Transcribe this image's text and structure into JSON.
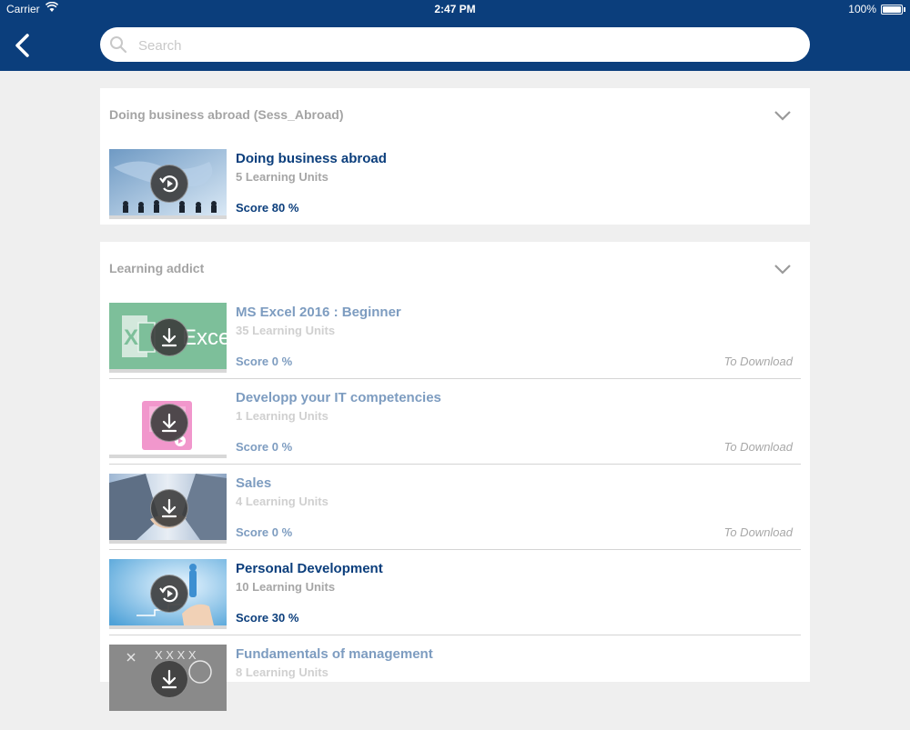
{
  "status_bar": {
    "carrier": "Carrier",
    "time": "2:47 PM",
    "battery": "100%"
  },
  "search": {
    "placeholder": "Search",
    "value": ""
  },
  "sections": [
    {
      "title": "Doing business abroad (Sess_Abroad)",
      "items": [
        {
          "title": "Doing business abroad",
          "units": "5 Learning Units",
          "score": "Score 80 %",
          "status": "",
          "icon": "resume-icon"
        }
      ]
    },
    {
      "title": "Learning addict",
      "items": [
        {
          "title": "MS Excel 2016 : Beginner",
          "units": "35 Learning Units",
          "score": "Score 0 %",
          "status": "To Download",
          "icon": "download-icon",
          "thumb_text": "Excel",
          "thumb_letter": "X"
        },
        {
          "title": "Developp your IT competencies",
          "units": "1 Learning Units",
          "score": "Score 0 %",
          "status": "To Download",
          "icon": "download-icon"
        },
        {
          "title": "Sales",
          "units": "4 Learning Units",
          "score": "Score 0 %",
          "status": "To Download",
          "icon": "download-icon"
        },
        {
          "title": "Personal Development",
          "units": "10 Learning Units",
          "score": "Score 30 %",
          "status": "",
          "icon": "resume-icon"
        },
        {
          "title": "Fundamentals of management",
          "units": "8 Learning Units",
          "score": "",
          "status": "",
          "icon": "download-icon",
          "thumb_text": "X X X X"
        }
      ]
    }
  ],
  "colors": {
    "header": "#0b3e7c",
    "accent_active": "#0b3e7c",
    "accent_muted": "#7d9cc0",
    "excel_green": "#7dbf9a"
  }
}
